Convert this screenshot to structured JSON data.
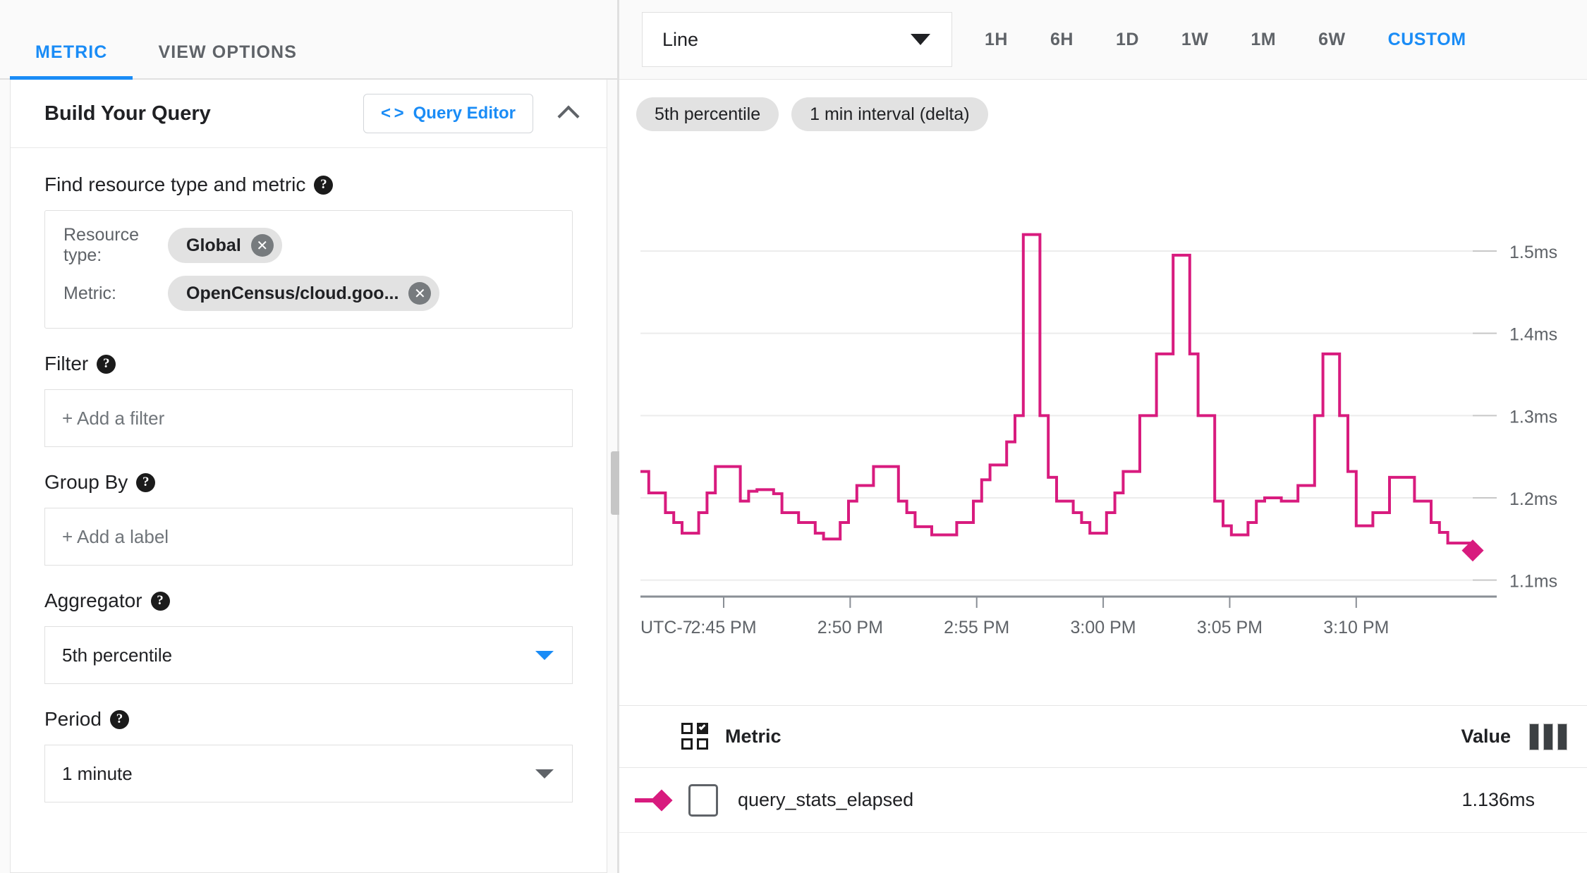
{
  "left_panel": {
    "tabs": [
      {
        "label": "METRIC",
        "active": true
      },
      {
        "label": "VIEW OPTIONS",
        "active": false
      }
    ],
    "card": {
      "title": "Build Your Query",
      "query_editor_label": "Query Editor",
      "code_glyph": "< >",
      "sections": {
        "find": {
          "label": "Find resource type and metric",
          "resource_type_label": "Resource type:",
          "resource_type_value": "Global",
          "metric_label": "Metric:",
          "metric_value": "OpenCensus/cloud.goo..."
        },
        "filter": {
          "label": "Filter",
          "placeholder": "+ Add a filter"
        },
        "group_by": {
          "label": "Group By",
          "placeholder": "+ Add a label"
        },
        "aggregator": {
          "label": "Aggregator",
          "value": "5th percentile"
        },
        "period": {
          "label": "Period",
          "value": "1 minute"
        }
      }
    }
  },
  "right_panel": {
    "chart_type_value": "Line",
    "time_ranges": [
      "1H",
      "6H",
      "1D",
      "1W",
      "1M",
      "6W"
    ],
    "custom_label": "CUSTOM",
    "stat_chips": [
      "5th percentile",
      "1 min interval (delta)"
    ],
    "legend": {
      "metric_header": "Metric",
      "value_header": "Value",
      "rows": [
        {
          "name": "query_stats_elapsed",
          "value": "1.136ms"
        }
      ]
    }
  },
  "colors": {
    "accent": "#1a8cf6",
    "series": "#d81b7e",
    "chip_bg": "#e2e2e2",
    "text": "#202124",
    "muted": "#5f6368"
  },
  "chart_data": {
    "type": "line",
    "title": "",
    "xlabel": "",
    "ylabel": "",
    "timezone_label": "UTC-7",
    "x_tick_labels": [
      "2:45 PM",
      "2:50 PM",
      "2:55 PM",
      "3:00 PM",
      "3:05 PM",
      "3:10 PM"
    ],
    "y_tick_labels": [
      "1.5ms",
      "1.4ms",
      "1.3ms",
      "1.2ms",
      "1.1ms"
    ],
    "ylim": [
      1.08,
      1.56
    ],
    "y_gridlines": [
      1.5,
      1.4,
      1.3,
      1.2,
      1.1
    ],
    "grid": true,
    "legend_position": "below-chart",
    "series": [
      {
        "name": "query_stats_elapsed",
        "color": "#d81b7e",
        "unit": "ms",
        "last_value": 1.136,
        "step": "step-after",
        "values": [
          1.232,
          1.206,
          1.206,
          1.182,
          1.17,
          1.157,
          1.157,
          1.182,
          1.206,
          1.238,
          1.238,
          1.238,
          1.196,
          1.208,
          1.21,
          1.21,
          1.205,
          1.182,
          1.182,
          1.17,
          1.17,
          1.157,
          1.15,
          1.15,
          1.17,
          1.196,
          1.215,
          1.215,
          1.238,
          1.238,
          1.238,
          1.196,
          1.182,
          1.165,
          1.165,
          1.155,
          1.155,
          1.155,
          1.17,
          1.17,
          1.196,
          1.222,
          1.24,
          1.24,
          1.268,
          1.3,
          1.52,
          1.52,
          1.3,
          1.225,
          1.196,
          1.196,
          1.182,
          1.17,
          1.157,
          1.157,
          1.182,
          1.206,
          1.232,
          1.232,
          1.3,
          1.3,
          1.375,
          1.375,
          1.495,
          1.495,
          1.375,
          1.3,
          1.3,
          1.196,
          1.166,
          1.155,
          1.155,
          1.17,
          1.196,
          1.2,
          1.2,
          1.196,
          1.196,
          1.215,
          1.215,
          1.3,
          1.375,
          1.375,
          1.3,
          1.232,
          1.166,
          1.166,
          1.182,
          1.182,
          1.225,
          1.225,
          1.225,
          1.196,
          1.196,
          1.17,
          1.158,
          1.145,
          1.145,
          1.145,
          1.136
        ]
      }
    ]
  }
}
